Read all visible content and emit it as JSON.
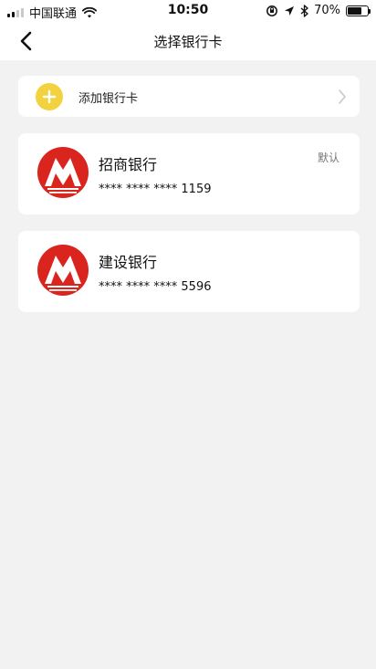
{
  "status_bar": {
    "carrier": "中国联通",
    "time": "10:50",
    "battery_text": "70%",
    "battery_level": 0.7
  },
  "nav": {
    "title": "选择银行卡"
  },
  "add_card": {
    "label": "添加银行卡"
  },
  "cards": [
    {
      "bank_name": "招商银行",
      "number": "**** **** **** 1159",
      "default_label": "默认"
    },
    {
      "bank_name": "建设银行",
      "number": "**** **** **** 5596"
    }
  ],
  "colors": {
    "accent_yellow": "#F2D23E",
    "logo_red": "#D9251D",
    "background": "#F2F2F2"
  },
  "icons": {
    "back": "chevron-left",
    "add": "plus",
    "disclosure": "chevron-right",
    "bank_logo": "cmb-logo"
  }
}
